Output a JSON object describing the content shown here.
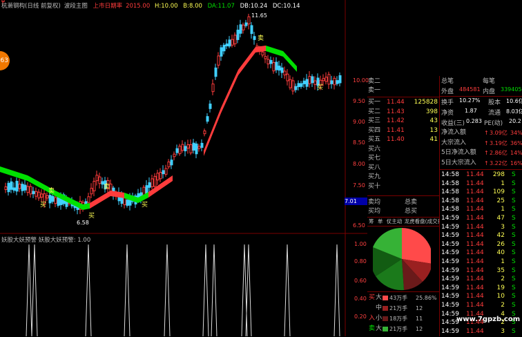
{
  "header": {
    "stock": "杭萧钢构(日线 前复权)",
    "indicator": "波段主图",
    "label_red": "上市日期率",
    "value_red": "2015.00",
    "h_label": "H:",
    "h_value": "10.00",
    "b_label": "B:",
    "b_value": "8.00",
    "da_label": "DA:",
    "da_value": "11.07",
    "db_label": "DB:",
    "db_value": "10.24",
    "dc_label": "DC:",
    "dc_value": "10.14"
  },
  "badge": "63",
  "annotations": {
    "high": "11.65",
    "low": "6.58",
    "buy": "买",
    "sell": "卖"
  },
  "price_axis": [
    "10.00",
    "9.50",
    "9.00",
    "8.50",
    "8.00",
    "7.50",
    "7.01",
    "6.50"
  ],
  "cursor_price": "7.01",
  "indicator_bar": {
    "name": "妖股大妖预警",
    "label": "妖股大妖预警:",
    "value": "1.00"
  },
  "ind_axis": [
    "1.00",
    "0.80",
    "0.60",
    "0.40",
    "0.20"
  ],
  "orderbook": {
    "sell": [
      {
        "label": "卖二",
        "price": "",
        "vol": ""
      },
      {
        "label": "卖一",
        "price": "",
        "vol": ""
      }
    ],
    "buy": [
      {
        "label": "买一",
        "price": "11.44",
        "vol": "125828"
      },
      {
        "label": "买二",
        "price": "11.43",
        "vol": "398"
      },
      {
        "label": "买三",
        "price": "11.42",
        "vol": "43"
      },
      {
        "label": "买四",
        "price": "11.41",
        "vol": "13"
      },
      {
        "label": "买五",
        "price": "11.40",
        "vol": "41"
      },
      {
        "label": "买六",
        "price": "",
        "vol": ""
      },
      {
        "label": "买七",
        "price": "",
        "vol": ""
      },
      {
        "label": "买八",
        "price": "",
        "vol": ""
      },
      {
        "label": "买九",
        "price": "",
        "vol": ""
      },
      {
        "label": "买十",
        "price": "",
        "vol": ""
      }
    ],
    "avg_sell": "卖均",
    "total_sell": "总卖",
    "avg_buy": "买均",
    "total_buy": "总买"
  },
  "tabs": [
    "筹",
    "单",
    "仗主动",
    "龙虎看盘(成交量)"
  ],
  "flow_table": [
    {
      "side": "买",
      "size": "大",
      "amount": "43万手",
      "pct": "25.86%"
    },
    {
      "side": "",
      "size": "中",
      "amount": "21万手",
      "pct": "12"
    },
    {
      "side": "入",
      "size": "小",
      "amount": "18万手",
      "pct": "11"
    },
    {
      "side": "卖",
      "size": "大",
      "amount": "21万手",
      "pct": "12"
    }
  ],
  "stats": {
    "zongbi": "总笔",
    "meibi": "每笔",
    "waipan_l": "外盘",
    "waipan_v": "484581",
    "neipan_l": "内盘",
    "neipan_v": "339405",
    "huanshou_l": "换手",
    "huanshou_v": "10.27%",
    "guben_l": "股本",
    "guben_v": "10.6亿",
    "jingzi_l": "净资",
    "jingzi_v": "1.87",
    "liutong_l": "流通",
    "liutong_v": "8.03亿",
    "shouyi_l": "收益(三)",
    "shouyi_v": "0.283",
    "pe_l": "PE(动)",
    "pe_v": "20.2",
    "flows": [
      {
        "label": "净流入额",
        "mark": "↑",
        "value": "3.09亿",
        "pct": "34%"
      },
      {
        "label": "大宗流入",
        "mark": "↑",
        "value": "3.19亿",
        "pct": "36%"
      },
      {
        "label": "5日净流入额",
        "mark": "↑",
        "value": "2.86亿",
        "pct": "14%"
      },
      {
        "label": "5日大宗流入",
        "mark": "↑",
        "value": "3.22亿",
        "pct": "16%"
      }
    ]
  },
  "ticks": [
    {
      "t": "14:58",
      "p": "11.44",
      "v": "298",
      "s": "S"
    },
    {
      "t": "14:58",
      "p": "11.44",
      "v": "1",
      "s": "S"
    },
    {
      "t": "14:58",
      "p": "11.44",
      "v": "109",
      "s": "S"
    },
    {
      "t": "14:58",
      "p": "11.44",
      "v": "25",
      "s": "S"
    },
    {
      "t": "14:58",
      "p": "11.44",
      "v": "1",
      "s": "S"
    },
    {
      "t": "14:59",
      "p": "11.44",
      "v": "47",
      "s": "S"
    },
    {
      "t": "14:59",
      "p": "11.44",
      "v": "3",
      "s": "S"
    },
    {
      "t": "14:59",
      "p": "11.44",
      "v": "42",
      "s": "S"
    },
    {
      "t": "14:59",
      "p": "11.44",
      "v": "26",
      "s": "S"
    },
    {
      "t": "14:59",
      "p": "11.44",
      "v": "40",
      "s": "S"
    },
    {
      "t": "14:59",
      "p": "11.44",
      "v": "1",
      "s": "S"
    },
    {
      "t": "14:59",
      "p": "11.44",
      "v": "35",
      "s": "S"
    },
    {
      "t": "14:59",
      "p": "11.44",
      "v": "2",
      "s": "S"
    },
    {
      "t": "14:59",
      "p": "11.44",
      "v": "19",
      "s": "S"
    },
    {
      "t": "14:59",
      "p": "11.44",
      "v": "10",
      "s": "S"
    },
    {
      "t": "14:59",
      "p": "11.44",
      "v": "2",
      "s": "S"
    },
    {
      "t": "14:59",
      "p": "11.44",
      "v": "4",
      "s": "S"
    },
    {
      "t": "14:59",
      "p": "11.44",
      "v": "2",
      "s": "S"
    },
    {
      "t": "14:59",
      "p": "11.44",
      "v": "3",
      "s": "S"
    }
  ],
  "watermark": "www.7gpzb.com",
  "colors": {
    "up": "#ff3c3c",
    "down": "#00e000",
    "accent": "#ffff54",
    "grid": "#7a0000"
  }
}
